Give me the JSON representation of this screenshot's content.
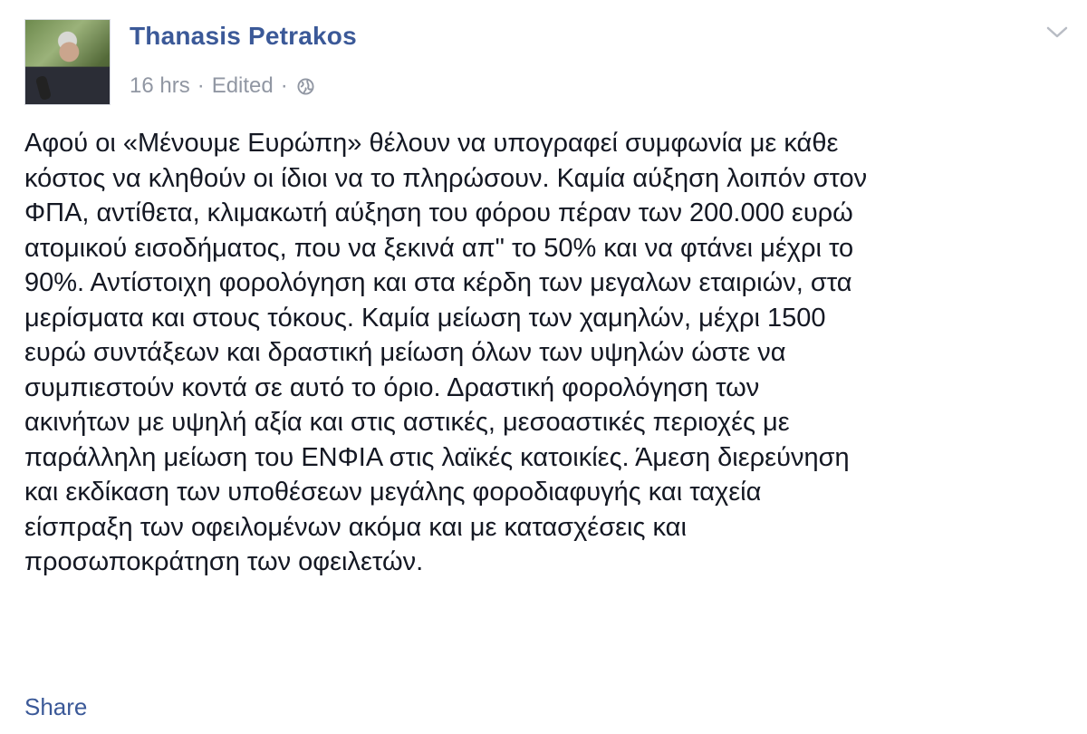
{
  "post": {
    "author": "Thanasis Petrakos",
    "time": "16 hrs",
    "separator": "·",
    "edited": "Edited",
    "privacy_icon": "globe-icon",
    "menu_icon": "chevron-down-icon",
    "body_lines": [
      "Αφού οι «Μένουμε Ευρώπη» θέλουν να υπογραφεί συμφωνία με κάθε",
      "κόστος να κληθούν οι ίδιοι να το πληρώσουν. Καμία αύξηση λοιπόν στον",
      "ΦΠΑ, αντίθετα, κλιμακωτή αύξηση του φόρου πέραν των 200.000 ευρώ",
      "ατομικού εισοδήματος, που να ξεκινά απ\" το 50% και να φτάνει μέχρι το",
      "90%. Αντίστοιχη φορολόγηση και στα κέρδη των μεγαλων εταιριών, στα",
      "μερίσματα και στους τόκους. Καμία μείωση των χαμηλών, μέχρι 1500",
      "ευρώ συντάξεων και δραστική μείωση όλων των υψηλών ώστε να",
      "συμπιεστούν κοντά σε αυτό το όριο. Δραστική φορολόγηση των",
      "ακινήτων με υψηλή αξία και στις αστικές, μεσοαστικές περιοχές με",
      "παράλληλη μείωση του ΕΝΦΙΑ στις λαϊκές κατοικίες. Άμεση διερεύνηση",
      "και εκδίκαση των υποθέσεων μεγάλης φοροδιαφυγής και ταχεία",
      "είσπραξη των οφειλομένων ακόμα και με κατασχέσεις και",
      "προσωποκράτηση των οφειλετών."
    ],
    "share_label": "Share"
  },
  "colors": {
    "link": "#3b5998",
    "meta": "#9197a3",
    "text": "#141823"
  }
}
